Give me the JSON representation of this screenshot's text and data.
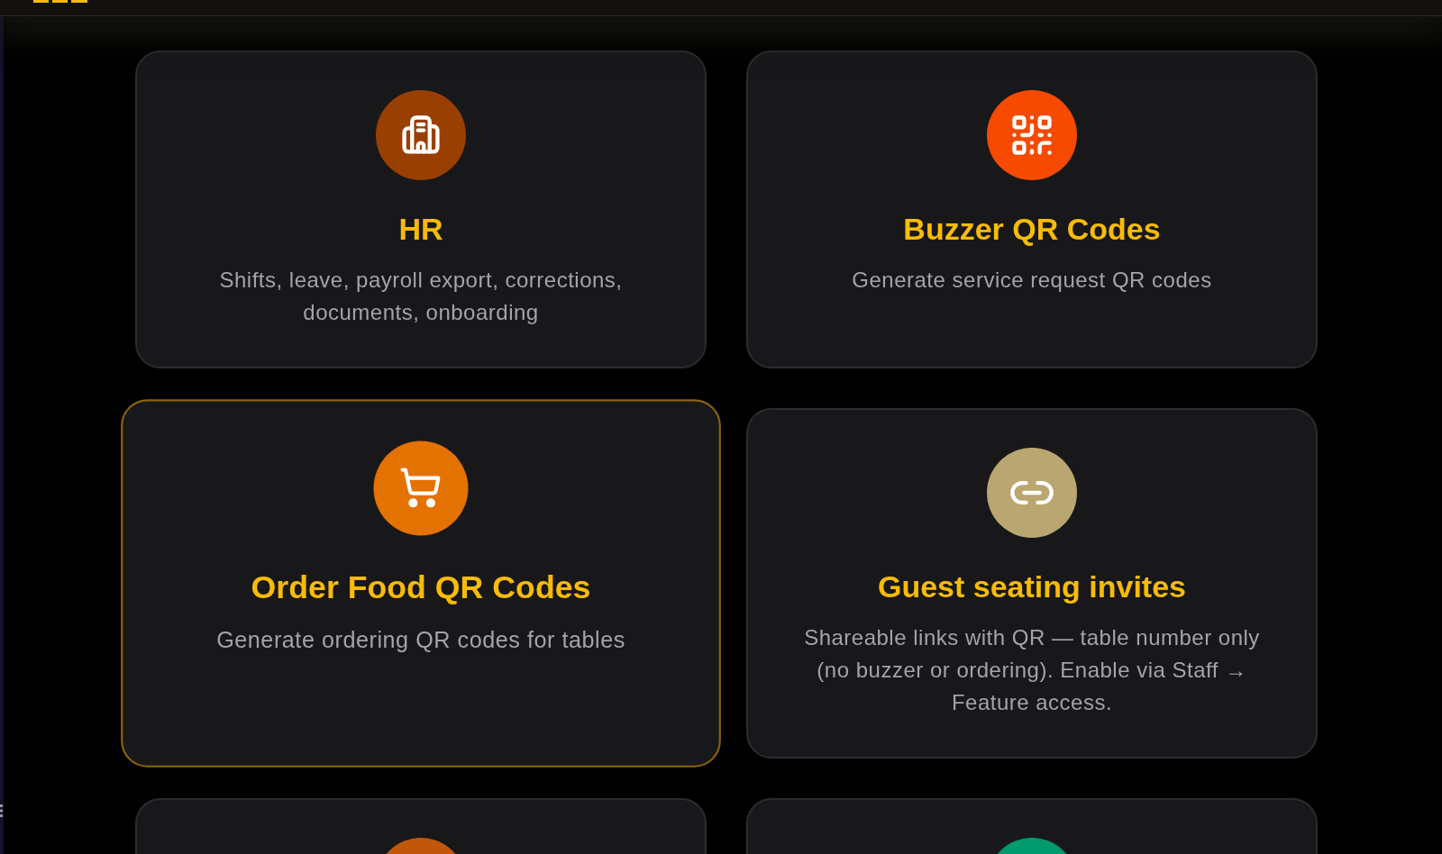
{
  "cards": [
    {
      "title": "HR",
      "description": "Shifts, leave, payroll export, corrections, documents, onboarding",
      "color": "#9a3f02",
      "selected": false
    },
    {
      "title": "Buzzer QR Codes",
      "description": "Generate service request QR codes",
      "color": "#f54a00",
      "selected": false
    },
    {
      "title": "Order Food QR Codes",
      "description": "Generate ordering QR codes for tables",
      "color": "#e37200",
      "selected": true
    },
    {
      "title": "Guest seating invites",
      "description": "Shareable links with QR — table number only (no buzzer or ordering). Enable via Staff → Feature access.",
      "color": "#baa670",
      "selected": false
    },
    {
      "color": "#c0570a",
      "selected": false
    },
    {
      "color": "#009a6d",
      "selected": false
    }
  ]
}
